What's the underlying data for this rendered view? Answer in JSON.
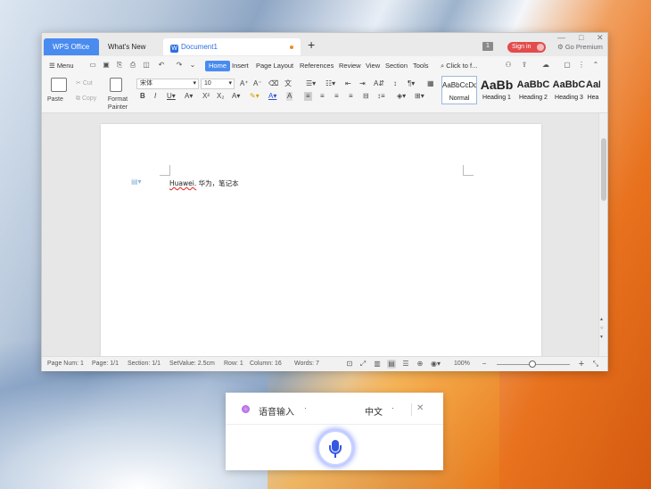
{
  "window": {
    "tabs": {
      "wps": "WPS Office",
      "whats_new": "What's New",
      "doc": "Document1"
    },
    "add_tab": "+",
    "badge": "1",
    "sign_in": "Sign in",
    "premium": "Go Premium",
    "controls": {
      "minimize": "—",
      "maximize": "□",
      "close": "✕"
    }
  },
  "menubar": {
    "menu": "Menu",
    "items": [
      "Home",
      "Insert",
      "Page Layout",
      "References",
      "Review",
      "View",
      "Section",
      "Tools"
    ],
    "search": "Click to f..."
  },
  "ribbon": {
    "paste": "Paste",
    "cut": "Cut",
    "copy": "Copy",
    "format_painter": "Format Painter",
    "font": "宋体",
    "size": "10",
    "styles": [
      {
        "preview": "AaBbCcDd",
        "label": "Normal"
      },
      {
        "preview": "AaBb",
        "label": "Heading 1"
      },
      {
        "preview": "AaBbC",
        "label": "Heading 2"
      },
      {
        "preview": "AaBbC",
        "label": "Heading 3"
      },
      {
        "preview": "AaB",
        "label": "Hea"
      }
    ]
  },
  "document": {
    "text_latin": "Huawei.",
    "text_cjk": " 华为，笔记本"
  },
  "status": {
    "page_num": "Page Num: 1",
    "page": "Page: 1/1",
    "section": "Section: 1/1",
    "setvalue": "SetValue: 2.5cm",
    "row": "Row: 1",
    "column": "Column: 16",
    "words": "Words: 7",
    "zoom": "100%"
  },
  "voice": {
    "title": "语音输入",
    "lang": "中文",
    "close": "✕"
  }
}
